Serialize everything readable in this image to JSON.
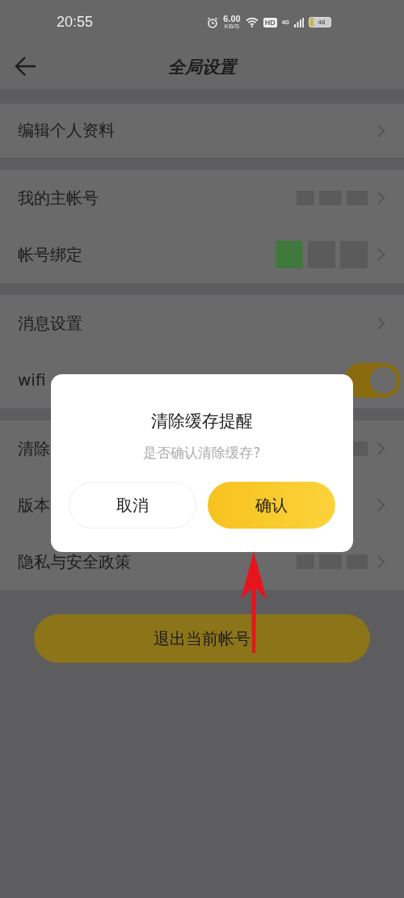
{
  "status_bar": {
    "time": "20:55",
    "speed": "6.00",
    "speed_unit": "KB/S",
    "hd_badge": "HD",
    "network_type": "4G",
    "battery": "48"
  },
  "header": {
    "title": "全局设置"
  },
  "sections": [
    {
      "rows": [
        {
          "kind": "link",
          "label": "编辑个人资料"
        }
      ]
    },
    {
      "rows": [
        {
          "kind": "masked",
          "label": "我的主帐号"
        },
        {
          "kind": "masked-icons",
          "label": "帐号绑定"
        }
      ]
    },
    {
      "rows": [
        {
          "kind": "link",
          "label": "消息设置"
        },
        {
          "kind": "toggle",
          "label": "wifi",
          "on": true
        }
      ]
    },
    {
      "rows": [
        {
          "kind": "masked",
          "label": "清除"
        },
        {
          "kind": "link",
          "label": "版本"
        },
        {
          "kind": "masked",
          "label": "隐私与安全政策"
        }
      ]
    }
  ],
  "logout_button": "退出当前帐号",
  "dialog": {
    "title": "清除缓存提醒",
    "message": "是否确认清除缓存?",
    "buttons": [
      {
        "kind": "secondary",
        "label": "取消"
      },
      {
        "kind": "primary",
        "label": "确认"
      }
    ]
  }
}
